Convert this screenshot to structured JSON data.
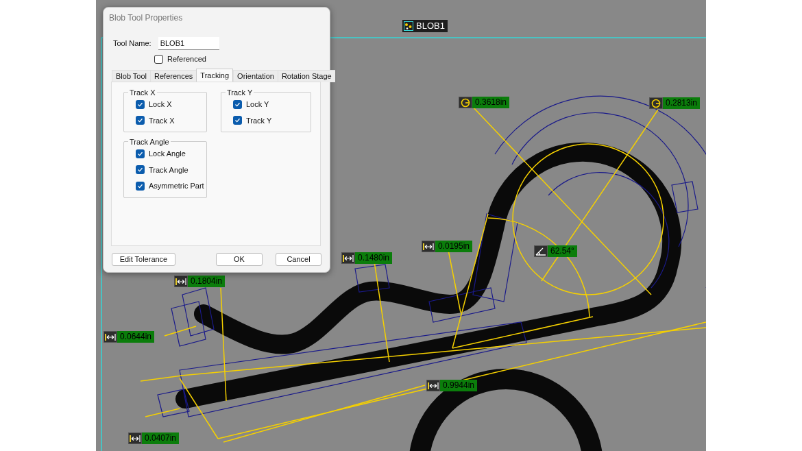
{
  "canvas": {
    "tool_label": "BLOB1",
    "measurements": [
      {
        "kind": "radius",
        "value": "0.3618in"
      },
      {
        "kind": "radius",
        "value": "0.2813in"
      },
      {
        "kind": "distance",
        "value": "0.0195in"
      },
      {
        "kind": "angle",
        "value": "62.54°"
      },
      {
        "kind": "distance",
        "value": "0.1480in"
      },
      {
        "kind": "distance",
        "value": "0.1804in"
      },
      {
        "kind": "distance",
        "value": "0.0644in"
      },
      {
        "kind": "distance",
        "value": "0.9944in"
      },
      {
        "kind": "distance",
        "value": "0.0407in"
      }
    ]
  },
  "dialog": {
    "title": "Blob Tool Properties",
    "tool_name_label": "Tool Name:",
    "tool_name": "BLOB1",
    "referenced": {
      "label": "Referenced",
      "checked": false
    },
    "tabs": [
      {
        "label": "Blob Tool",
        "selected": false
      },
      {
        "label": "References",
        "selected": false
      },
      {
        "label": "Tracking",
        "selected": true
      },
      {
        "label": "Orientation",
        "selected": false
      },
      {
        "label": "Rotation Stage",
        "selected": false
      }
    ],
    "groups": [
      {
        "title": "Track X",
        "options": [
          {
            "label": "Lock X",
            "checked": true
          },
          {
            "label": "Track X",
            "checked": true
          }
        ]
      },
      {
        "title": "Track Y",
        "options": [
          {
            "label": "Lock Y",
            "checked": true
          },
          {
            "label": "Track Y",
            "checked": true
          }
        ]
      },
      {
        "title": "Track Angle",
        "options": [
          {
            "label": "Lock Angle",
            "checked": true
          },
          {
            "label": "Track Angle",
            "checked": true
          },
          {
            "label": "Asymmetric Part",
            "checked": true
          }
        ]
      }
    ],
    "buttons": [
      "Edit Tolerance",
      "OK",
      "Cancel"
    ]
  }
}
